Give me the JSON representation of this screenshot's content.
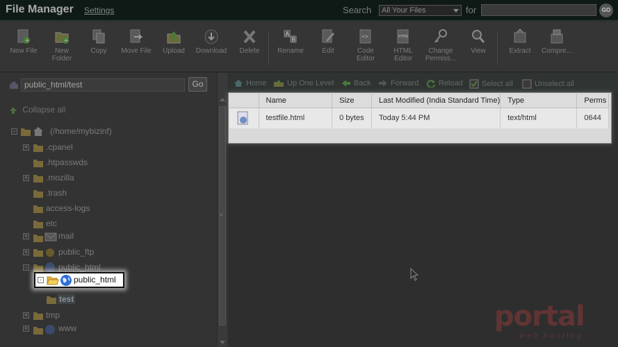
{
  "header": {
    "title": "File Manager",
    "settings_link": "Settings",
    "search_label": "Search",
    "search_scope": "All Your Files",
    "for_label": "for",
    "search_value": "",
    "go_label": "GO"
  },
  "toolbar": {
    "items": [
      {
        "label": "New File",
        "icon": "new-file-icon"
      },
      {
        "label": "New\nFolder",
        "icon": "new-folder-icon"
      },
      {
        "label": "Copy",
        "icon": "copy-icon"
      },
      {
        "label": "Move File",
        "icon": "move-file-icon"
      },
      {
        "label": "Upload",
        "icon": "upload-icon"
      },
      {
        "label": "Download",
        "icon": "download-icon"
      },
      {
        "label": "Delete",
        "icon": "delete-icon"
      },
      {
        "label": "Rename",
        "icon": "rename-icon"
      },
      {
        "label": "Edit",
        "icon": "edit-icon"
      },
      {
        "label": "Code\nEditor",
        "icon": "code-editor-icon"
      },
      {
        "label": "HTML\nEditor",
        "icon": "html-editor-icon"
      },
      {
        "label": "Change\nPermiss...",
        "icon": "change-permissions-icon"
      },
      {
        "label": "View",
        "icon": "view-icon"
      },
      {
        "label": "Extract",
        "icon": "extract-icon"
      },
      {
        "label": "Compre...",
        "icon": "compress-icon"
      }
    ]
  },
  "left": {
    "path_value": "public_html/test",
    "go_label": "Go",
    "collapse_label": "Collapse all",
    "tree": [
      {
        "label": "(/home/mybizinf)"
      },
      {
        "label": ".cpanel"
      },
      {
        "label": ".htpasswds"
      },
      {
        "label": ".mozilla"
      },
      {
        "label": ".trash"
      },
      {
        "label": "access-logs"
      },
      {
        "label": "etc"
      },
      {
        "label": "mail"
      },
      {
        "label": "public_ftp"
      },
      {
        "label": "public_html"
      },
      {
        "label": "public_html"
      },
      {
        "label": "test"
      },
      {
        "label": "tmp"
      },
      {
        "label": "www"
      }
    ]
  },
  "right": {
    "nav": [
      {
        "label": "Home",
        "icon": "home-icon"
      },
      {
        "label": "Up One Level",
        "icon": "up-level-icon"
      },
      {
        "label": "Back",
        "icon": "back-arrow-icon"
      },
      {
        "label": "Forward",
        "icon": "forward-arrow-icon"
      },
      {
        "label": "Reload",
        "icon": "reload-icon"
      },
      {
        "label": "Select all",
        "icon": "checkbox-checked-icon"
      },
      {
        "label": "Unselect all",
        "icon": "checkbox-empty-icon"
      }
    ],
    "columns": [
      "",
      "Name",
      "Size",
      "Last Modified (India Standard Time)",
      "Type",
      "Perms"
    ],
    "rows": [
      {
        "name": "testfile.html",
        "size": "0 bytes",
        "modified": "Today 5:44 PM",
        "type": "text/html",
        "perms": "0644"
      }
    ]
  },
  "watermark": {
    "brand": "portal",
    "sub": "web hosting"
  },
  "colors": {
    "topbar": "#0f1a17",
    "highlight_box": "#ffffff",
    "table_bg": "#e8e8e8"
  }
}
